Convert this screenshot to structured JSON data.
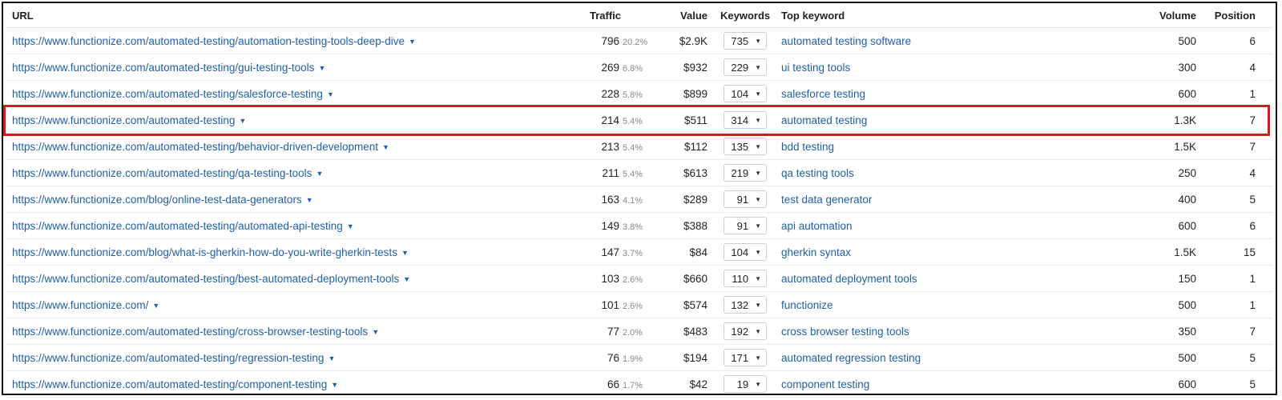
{
  "colors": {
    "link": "#1f5fa8",
    "highlight_border": "#d8181c"
  },
  "columns": {
    "url": "URL",
    "traffic": "Traffic",
    "value": "Value",
    "keywords": "Keywords",
    "top_keyword": "Top keyword",
    "volume": "Volume",
    "position": "Position"
  },
  "icons": {
    "url_caret": "caret-down-icon",
    "keywords_caret": "triangle-down-icon"
  },
  "highlighted_row": 3,
  "rows": [
    {
      "url": "https://www.functionize.com/automated-testing/automation-testing-tools-deep-dive",
      "traffic": "796",
      "traffic_pct": "20.2%",
      "value": "$2.9K",
      "keywords": "735",
      "top_keyword": "automated testing software",
      "volume": "500",
      "position": "6"
    },
    {
      "url": "https://www.functionize.com/automated-testing/gui-testing-tools",
      "traffic": "269",
      "traffic_pct": "6.8%",
      "value": "$932",
      "keywords": "229",
      "top_keyword": "ui testing tools",
      "volume": "300",
      "position": "4"
    },
    {
      "url": "https://www.functionize.com/automated-testing/salesforce-testing",
      "traffic": "228",
      "traffic_pct": "5.8%",
      "value": "$899",
      "keywords": "104",
      "top_keyword": "salesforce testing",
      "volume": "600",
      "position": "1"
    },
    {
      "url": "https://www.functionize.com/automated-testing",
      "traffic": "214",
      "traffic_pct": "5.4%",
      "value": "$511",
      "keywords": "314",
      "top_keyword": "automated testing",
      "volume": "1.3K",
      "position": "7"
    },
    {
      "url": "https://www.functionize.com/automated-testing/behavior-driven-development",
      "traffic": "213",
      "traffic_pct": "5.4%",
      "value": "$112",
      "keywords": "135",
      "top_keyword": "bdd testing",
      "volume": "1.5K",
      "position": "7"
    },
    {
      "url": "https://www.functionize.com/automated-testing/qa-testing-tools",
      "traffic": "211",
      "traffic_pct": "5.4%",
      "value": "$613",
      "keywords": "219",
      "top_keyword": "qa testing tools",
      "volume": "250",
      "position": "4"
    },
    {
      "url": "https://www.functionize.com/blog/online-test-data-generators",
      "traffic": "163",
      "traffic_pct": "4.1%",
      "value": "$289",
      "keywords": "91",
      "top_keyword": "test data generator",
      "volume": "400",
      "position": "5"
    },
    {
      "url": "https://www.functionize.com/automated-testing/automated-api-testing",
      "traffic": "149",
      "traffic_pct": "3.8%",
      "value": "$388",
      "keywords": "91",
      "top_keyword": "api automation",
      "volume": "600",
      "position": "6"
    },
    {
      "url": "https://www.functionize.com/blog/what-is-gherkin-how-do-you-write-gherkin-tests",
      "traffic": "147",
      "traffic_pct": "3.7%",
      "value": "$84",
      "keywords": "104",
      "top_keyword": "gherkin syntax",
      "volume": "1.5K",
      "position": "15"
    },
    {
      "url": "https://www.functionize.com/automated-testing/best-automated-deployment-tools",
      "traffic": "103",
      "traffic_pct": "2.6%",
      "value": "$660",
      "keywords": "110",
      "top_keyword": "automated deployment tools",
      "volume": "150",
      "position": "1"
    },
    {
      "url": "https://www.functionize.com/",
      "traffic": "101",
      "traffic_pct": "2.6%",
      "value": "$574",
      "keywords": "132",
      "top_keyword": "functionize",
      "volume": "500",
      "position": "1"
    },
    {
      "url": "https://www.functionize.com/automated-testing/cross-browser-testing-tools",
      "traffic": "77",
      "traffic_pct": "2.0%",
      "value": "$483",
      "keywords": "192",
      "top_keyword": "cross browser testing tools",
      "volume": "350",
      "position": "7"
    },
    {
      "url": "https://www.functionize.com/automated-testing/regression-testing",
      "traffic": "76",
      "traffic_pct": "1.9%",
      "value": "$194",
      "keywords": "171",
      "top_keyword": "automated regression testing",
      "volume": "500",
      "position": "5"
    },
    {
      "url": "https://www.functionize.com/automated-testing/component-testing",
      "traffic": "66",
      "traffic_pct": "1.7%",
      "value": "$42",
      "keywords": "19",
      "top_keyword": "component testing",
      "volume": "600",
      "position": "5"
    }
  ]
}
